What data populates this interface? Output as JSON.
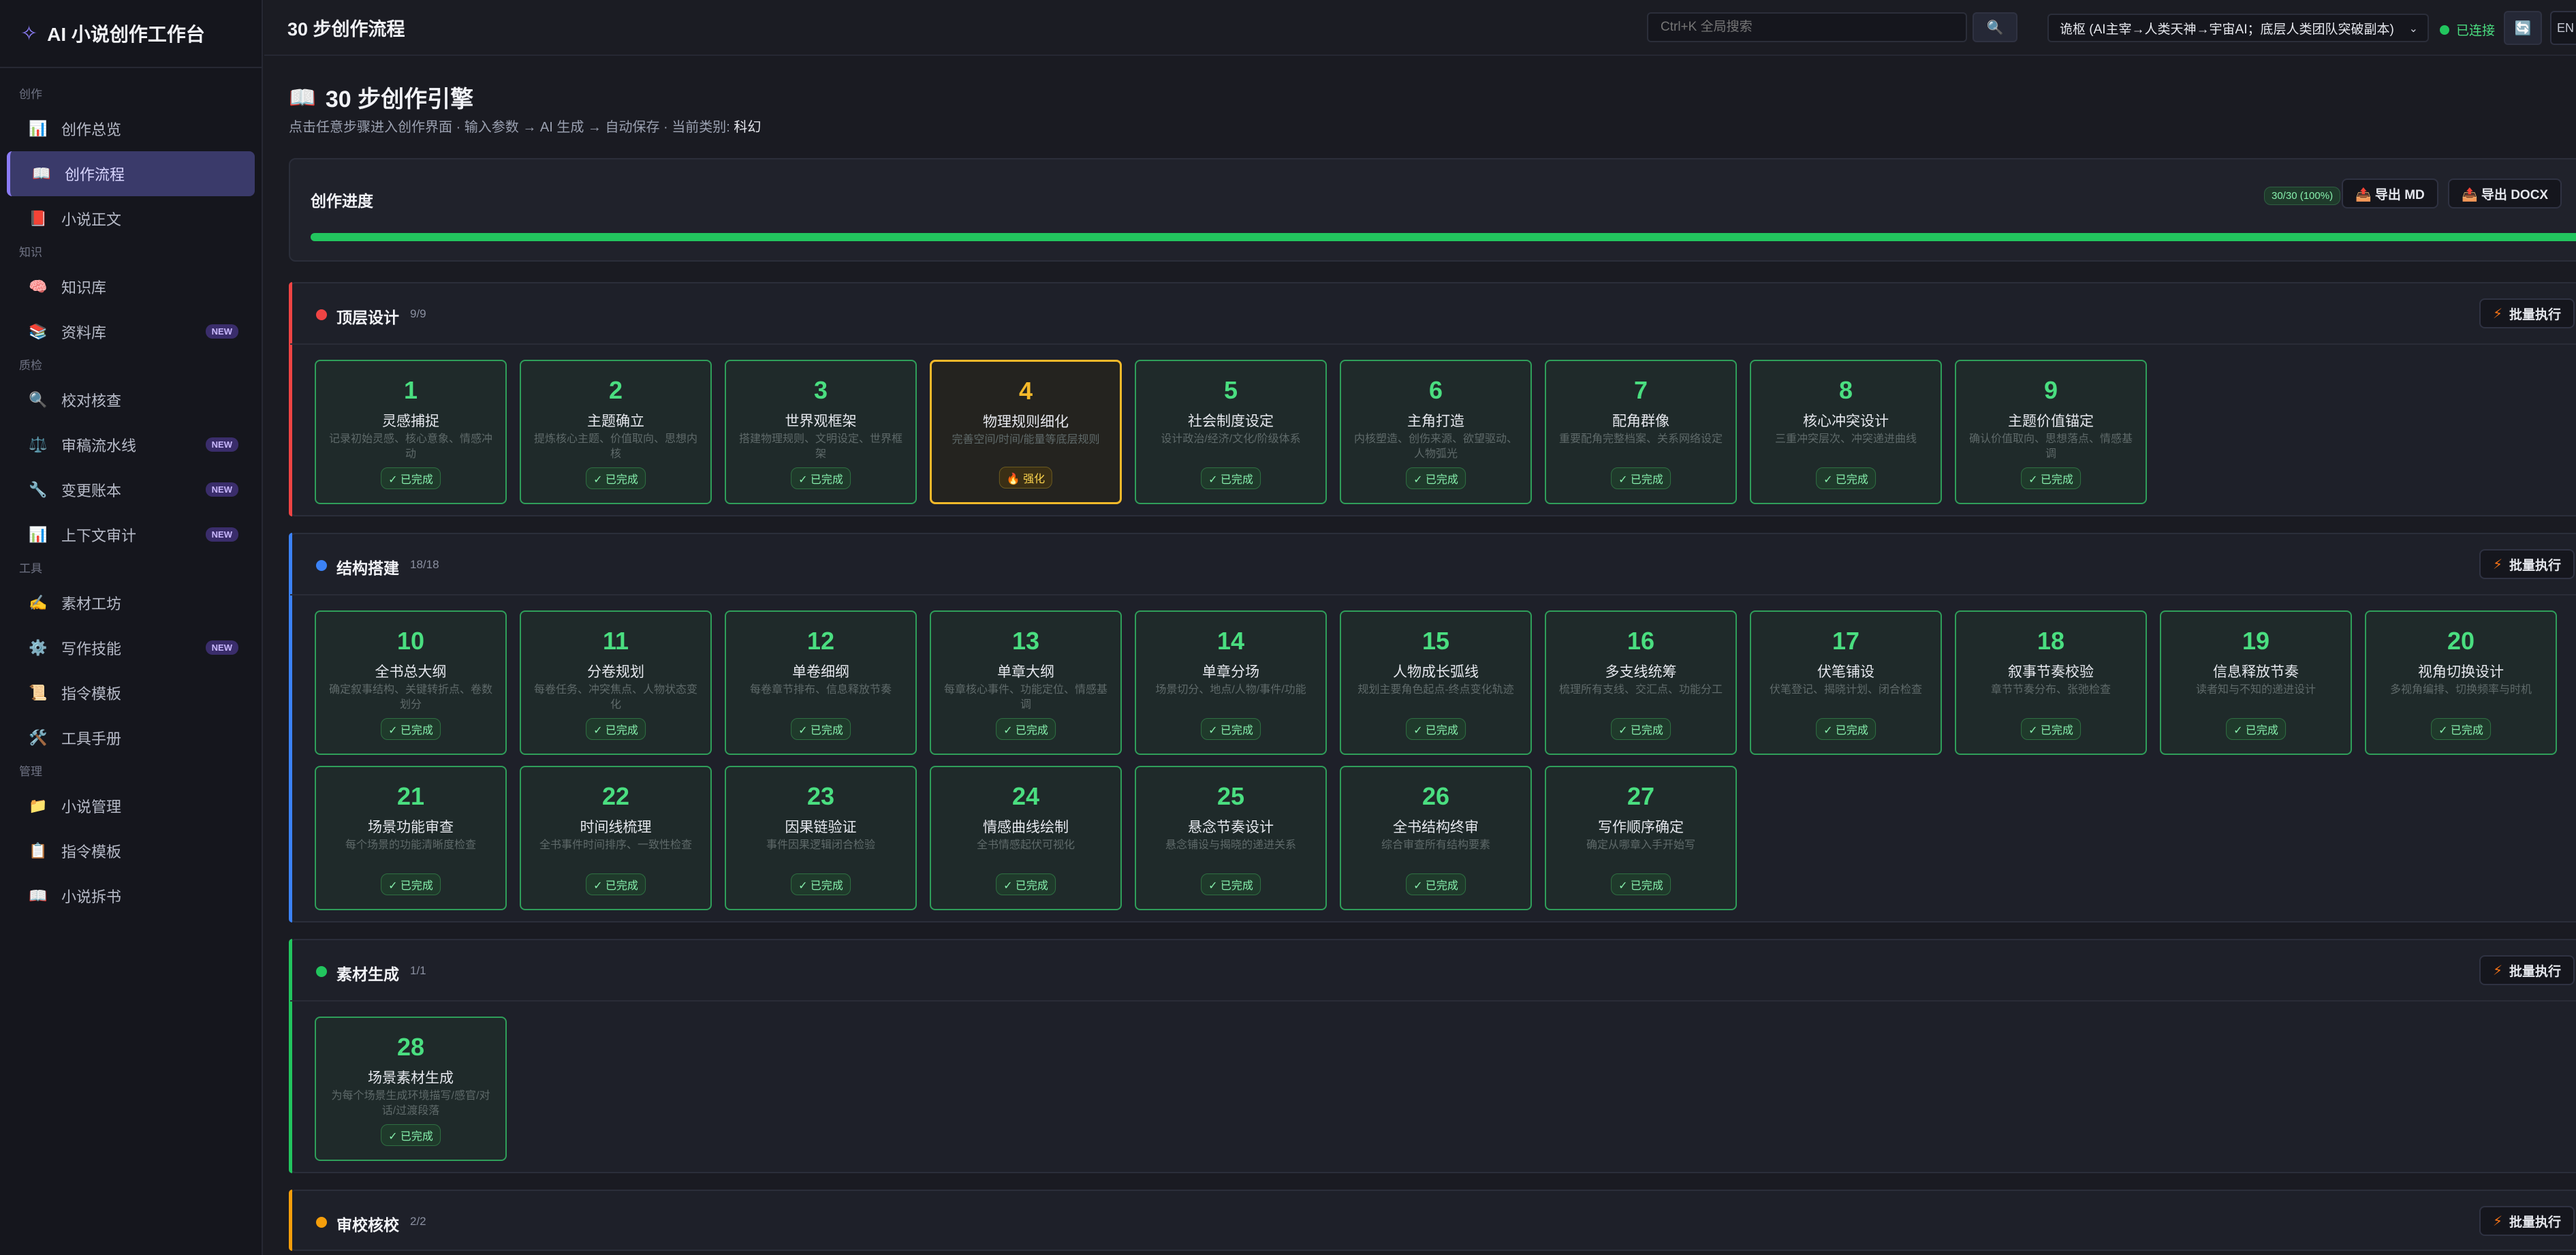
{
  "app": {
    "name": "AI 小说创作工作台"
  },
  "sidebar": {
    "sections": [
      {
        "label": "创作",
        "items": [
          {
            "label": "创作总览",
            "icon": "📊",
            "icon_name": "bar-chart-icon"
          },
          {
            "label": "创作流程",
            "icon": "📖",
            "icon_name": "open-book-icon",
            "active": true
          },
          {
            "label": "小说正文",
            "icon": "📕",
            "icon_name": "red-book-icon"
          }
        ]
      },
      {
        "label": "知识",
        "items": [
          {
            "label": "知识库",
            "icon": "🧠",
            "icon_name": "brain-icon"
          },
          {
            "label": "资料库",
            "icon": "📚",
            "icon_name": "books-icon",
            "badge": "NEW"
          }
        ]
      },
      {
        "label": "质检",
        "items": [
          {
            "label": "校对核查",
            "icon": "🔍",
            "icon_name": "magnifier-icon"
          },
          {
            "label": "审稿流水线",
            "icon": "⚖️",
            "icon_name": "scales-icon",
            "badge": "NEW"
          },
          {
            "label": "变更账本",
            "icon": "🔧",
            "icon_name": "wrench-icon",
            "badge": "NEW"
          },
          {
            "label": "上下文审计",
            "icon": "📊",
            "icon_name": "bar-chart-icon",
            "badge": "NEW"
          }
        ]
      },
      {
        "label": "工具",
        "items": [
          {
            "label": "素材工坊",
            "icon": "✍️",
            "icon_name": "writing-hand-icon"
          },
          {
            "label": "写作技能",
            "icon": "⚙️",
            "icon_name": "gear-icon",
            "badge": "NEW"
          },
          {
            "label": "指令模板",
            "icon": "📜",
            "icon_name": "scroll-icon"
          },
          {
            "label": "工具手册",
            "icon": "🛠️",
            "icon_name": "tools-icon"
          }
        ]
      },
      {
        "label": "管理",
        "items": [
          {
            "label": "小说管理",
            "icon": "📁",
            "icon_name": "folder-icon"
          },
          {
            "label": "指令模板",
            "icon": "📋",
            "icon_name": "clipboard-icon"
          },
          {
            "label": "小说拆书",
            "icon": "📖",
            "icon_name": "book-icon"
          }
        ]
      }
    ]
  },
  "header": {
    "title": "30 步创作流程",
    "search_placeholder": "Ctrl+K 全局搜索",
    "search_icon": "🔍",
    "novel_selected": "诡枢 (AI主宰→人类天神→宇宙AI；底层人类团队突破副本)",
    "connection": "已连接",
    "refresh_icon": "🔄",
    "lang": "EN"
  },
  "engine": {
    "icon": "📖",
    "title": "30 步创作引擎",
    "subtitle": "点击任意步骤进入创作界面 · 输入参数 → AI 生成 → 自动保存 · 当前类别:",
    "category": "科幻"
  },
  "progress": {
    "title": "创作进度",
    "badge": "30/30 (100%)",
    "fraction": 1.0,
    "export_md": "📤 导出 MD",
    "export_docx": "📤 导出 DOCX"
  },
  "batch_label": "批量执行",
  "bolt_icon": "⚡",
  "phases": [
    {
      "name": "顶层设计",
      "count": "9/9",
      "color": "#ef4444",
      "expanded": true,
      "steps": [
        {
          "num": "1",
          "title": "灵感捕捉",
          "desc": "记录初始灵感、核心意象、情感冲动",
          "status": "✓ 已完成"
        },
        {
          "num": "2",
          "title": "主题确立",
          "desc": "提炼核心主题、价值取向、思想内核",
          "status": "✓ 已完成"
        },
        {
          "num": "3",
          "title": "世界观框架",
          "desc": "搭建物理规则、文明设定、世界框架",
          "status": "✓ 已完成"
        },
        {
          "num": "4",
          "title": "物理规则细化",
          "desc": "完善空间/时间/能量等底层规则",
          "status": "🔥 强化",
          "active": true
        },
        {
          "num": "5",
          "title": "社会制度设定",
          "desc": "设计政治/经济/文化/阶级体系",
          "status": "✓ 已完成"
        },
        {
          "num": "6",
          "title": "主角打造",
          "desc": "内核塑造、创伤来源、欲望驱动、人物弧光",
          "status": "✓ 已完成"
        },
        {
          "num": "7",
          "title": "配角群像",
          "desc": "重要配角完整档案、关系网络设定",
          "status": "✓ 已完成"
        },
        {
          "num": "8",
          "title": "核心冲突设计",
          "desc": "三重冲突层次、冲突递进曲线",
          "status": "✓ 已完成"
        },
        {
          "num": "9",
          "title": "主题价值锚定",
          "desc": "确认价值取向、思想落点、情感基调",
          "status": "✓ 已完成"
        }
      ]
    },
    {
      "name": "结构搭建",
      "count": "18/18",
      "color": "#3b82f6",
      "expanded": true,
      "steps": [
        {
          "num": "10",
          "title": "全书总大纲",
          "desc": "确定叙事结构、关键转折点、卷数划分",
          "status": "✓ 已完成"
        },
        {
          "num": "11",
          "title": "分卷规划",
          "desc": "每卷任务、冲突焦点、人物状态变化",
          "status": "✓ 已完成"
        },
        {
          "num": "12",
          "title": "单卷细纲",
          "desc": "每卷章节排布、信息释放节奏",
          "status": "✓ 已完成"
        },
        {
          "num": "13",
          "title": "单章大纲",
          "desc": "每章核心事件、功能定位、情感基调",
          "status": "✓ 已完成"
        },
        {
          "num": "14",
          "title": "单章分场",
          "desc": "场景切分、地点/人物/事件/功能",
          "status": "✓ 已完成"
        },
        {
          "num": "15",
          "title": "人物成长弧线",
          "desc": "规划主要角色起点-终点变化轨迹",
          "status": "✓ 已完成"
        },
        {
          "num": "16",
          "title": "多支线统筹",
          "desc": "梳理所有支线、交汇点、功能分工",
          "status": "✓ 已完成"
        },
        {
          "num": "17",
          "title": "伏笔铺设",
          "desc": "伏笔登记、揭晓计划、闭合检查",
          "status": "✓ 已完成"
        },
        {
          "num": "18",
          "title": "叙事节奏校验",
          "desc": "章节节奏分布、张弛检查",
          "status": "✓ 已完成"
        },
        {
          "num": "19",
          "title": "信息释放节奏",
          "desc": "读者知与不知的递进设计",
          "status": "✓ 已完成"
        },
        {
          "num": "20",
          "title": "视角切换设计",
          "desc": "多视角编排、切换频率与时机",
          "status": "✓ 已完成"
        },
        {
          "num": "21",
          "title": "场景功能审查",
          "desc": "每个场景的功能清晰度检查",
          "status": "✓ 已完成"
        },
        {
          "num": "22",
          "title": "时间线梳理",
          "desc": "全书事件时间排序、一致性检查",
          "status": "✓ 已完成"
        },
        {
          "num": "23",
          "title": "因果链验证",
          "desc": "事件因果逻辑闭合检验",
          "status": "✓ 已完成"
        },
        {
          "num": "24",
          "title": "情感曲线绘制",
          "desc": "全书情感起伏可视化",
          "status": "✓ 已完成"
        },
        {
          "num": "25",
          "title": "悬念节奏设计",
          "desc": "悬念铺设与揭晓的递进关系",
          "status": "✓ 已完成"
        },
        {
          "num": "26",
          "title": "全书结构终审",
          "desc": "综合审查所有结构要素",
          "status": "✓ 已完成"
        },
        {
          "num": "27",
          "title": "写作顺序确定",
          "desc": "确定从哪章入手开始写",
          "status": "✓ 已完成"
        }
      ]
    },
    {
      "name": "素材生成",
      "count": "1/1",
      "color": "#22c55e",
      "expanded": true,
      "steps": [
        {
          "num": "28",
          "title": "场景素材生成",
          "desc": "为每个场景生成环境描写/感官/对话/过渡段落",
          "status": "✓ 已完成"
        }
      ]
    },
    {
      "name": "审校核校",
      "count": "2/2",
      "color": "#f59e0b",
      "expanded": false,
      "steps": []
    }
  ]
}
